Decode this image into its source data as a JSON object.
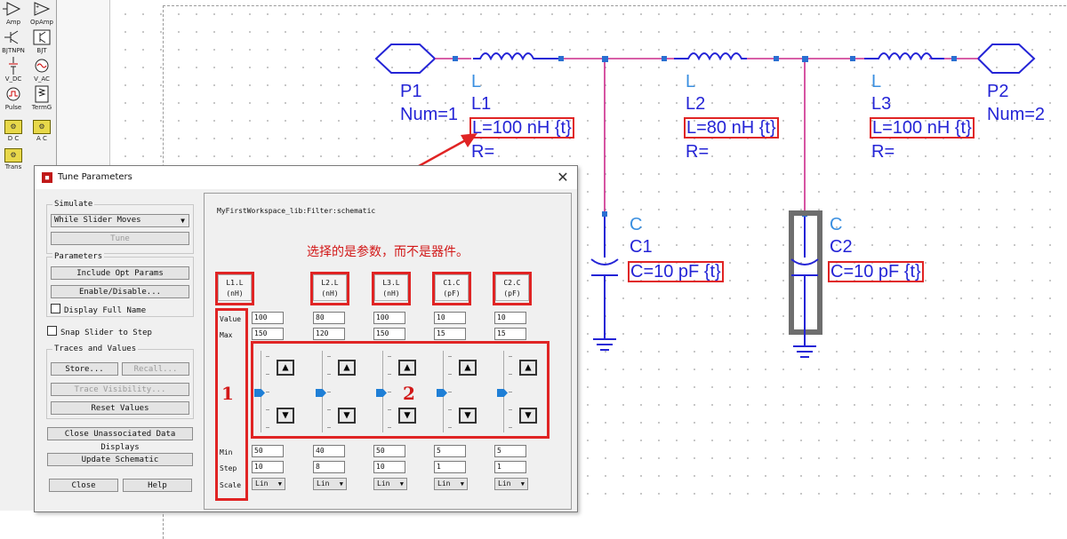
{
  "palette": {
    "items": [
      {
        "label": "Amp",
        "icon": "amplifier-icon"
      },
      {
        "label": "OpAmp",
        "icon": "opamp-icon"
      },
      {
        "label": "BJTNPN",
        "icon": "bjt-npn-icon"
      },
      {
        "label": "BJT",
        "icon": "bjt-icon"
      },
      {
        "label": "V_DC",
        "icon": "dc-source-icon"
      },
      {
        "label": "V_AC",
        "icon": "ac-source-icon"
      },
      {
        "label": "Pulse",
        "icon": "pulse-source-icon"
      },
      {
        "label": "TermG",
        "icon": "term-icon"
      },
      {
        "label": "D C",
        "icon": "dc-sim-icon"
      },
      {
        "label": "A C",
        "icon": "ac-sim-icon"
      },
      {
        "label": "Trans",
        "icon": "transient-sim-icon"
      }
    ]
  },
  "schematic": {
    "p1": {
      "name": "P1",
      "num": "Num=1"
    },
    "p2": {
      "name": "P2",
      "num": "Num=2"
    },
    "l1": {
      "type": "L",
      "name": "L1",
      "value": "L=100 nH {t}",
      "r": "R="
    },
    "l2": {
      "type": "L",
      "name": "L2",
      "value": "L=80 nH {t}",
      "r": "R="
    },
    "l3": {
      "type": "L",
      "name": "L3",
      "value": "L=100 nH {t}",
      "r": "R="
    },
    "c1": {
      "type": "C",
      "name": "C1",
      "value": "C=10 pF {t}"
    },
    "c2": {
      "type": "C",
      "name": "C2",
      "value": "C=10 pF {t}"
    },
    "wire_color": "#cc2a8a",
    "component_color": "#2424d6"
  },
  "annotations": {
    "note": "选择的是参数，而不是器件。",
    "marker1": "1",
    "marker2": "2",
    "color": "#d21818"
  },
  "dialog": {
    "title": "Tune Parameters",
    "close_glyph": "✕",
    "simulate": {
      "group_title": "Simulate",
      "mode": "While Slider Moves",
      "tune_button": "Tune"
    },
    "parameters": {
      "group_title": "Parameters",
      "include_opt": "Include Opt Params",
      "enable_disable": "Enable/Disable...",
      "display_full_name": "Display Full Name"
    },
    "snap_slider": "Snap Slider to Step",
    "traces": {
      "group_title": "Traces and Values",
      "store": "Store...",
      "recall": "Recall...",
      "trace_visibility": "Trace Visibility...",
      "reset_values": "Reset Values"
    },
    "close_unassociated": "Close Unassociated Data Displays",
    "update_schematic": "Update Schematic",
    "close_button": "Close",
    "help_button": "Help",
    "schematic_path": "MyFirstWorkspace_lib:Filter:schematic",
    "row_labels": {
      "value": "Value",
      "max": "Max",
      "min": "Min",
      "step": "Step",
      "scale": "Scale"
    },
    "columns": [
      {
        "name": "L1.L",
        "unit": "(nH)",
        "value": "100",
        "max": "150",
        "min": "50",
        "step": "10",
        "scale": "Lin",
        "slider": 0.5
      },
      {
        "name": "L2.L",
        "unit": "(nH)",
        "value": "80",
        "max": "120",
        "min": "40",
        "step": "8",
        "scale": "Lin",
        "slider": 0.5
      },
      {
        "name": "L3.L",
        "unit": "(nH)",
        "value": "100",
        "max": "150",
        "min": "50",
        "step": "10",
        "scale": "Lin",
        "slider": 0.5
      },
      {
        "name": "C1.C",
        "unit": "(pF)",
        "value": "10",
        "max": "15",
        "min": "5",
        "step": "1",
        "scale": "Lin",
        "slider": 0.5
      },
      {
        "name": "C2.C",
        "unit": "(pF)",
        "value": "10",
        "max": "15",
        "min": "5",
        "step": "1",
        "scale": "Lin",
        "slider": 0.5
      }
    ]
  }
}
